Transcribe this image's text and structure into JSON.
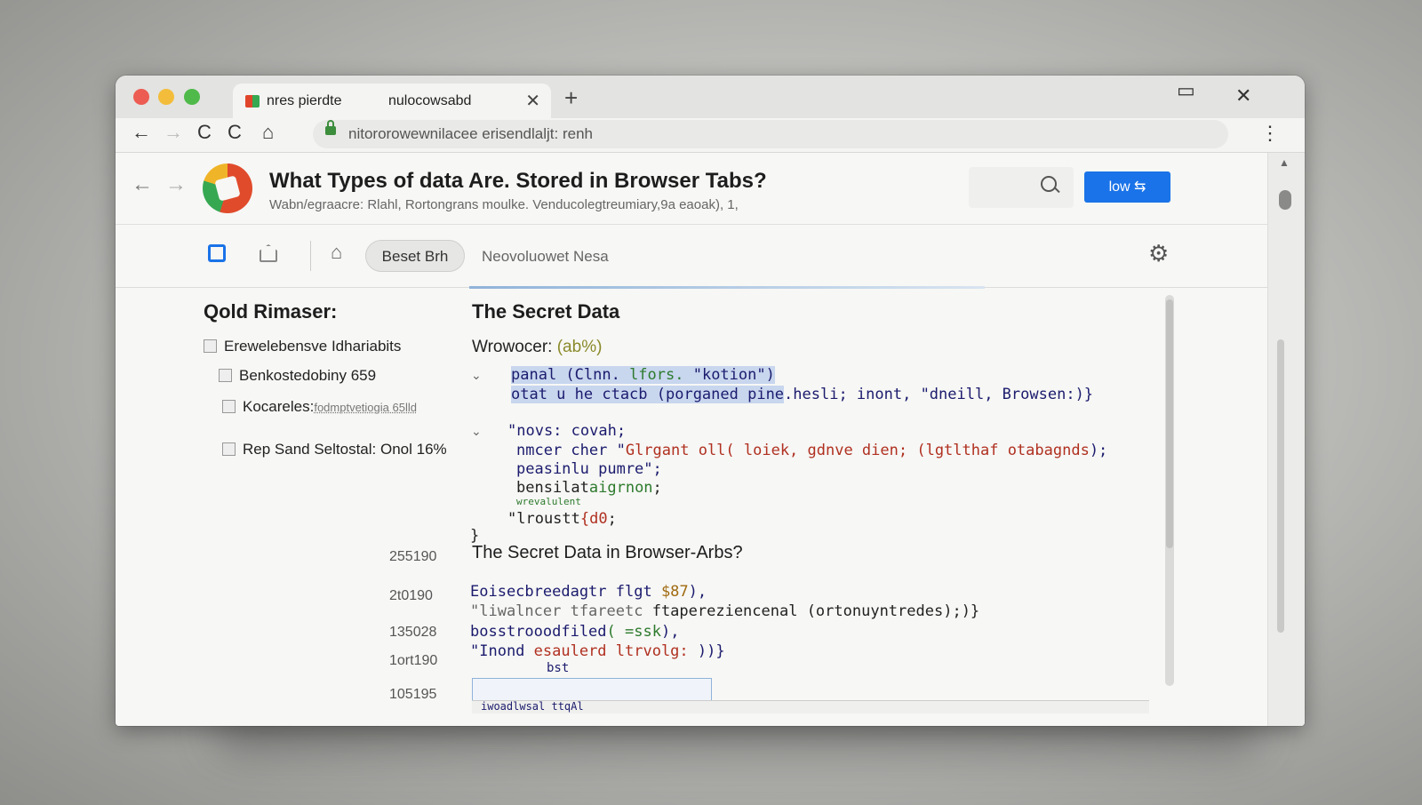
{
  "browser": {
    "tab": {
      "title": "nres pierdte",
      "title2": "nulocowsabd",
      "close": "✕"
    },
    "new_tab": "+",
    "window_controls": {
      "minimize": "▭",
      "close": "✕"
    },
    "nav": {
      "back": "←",
      "forward": "→",
      "reload": "C",
      "reload2": "C",
      "home": "⌂"
    },
    "url": "nitororowewnilacee erisendlaljt: renh",
    "menu": "⋮"
  },
  "site": {
    "back": "←",
    "forward": "→",
    "title": "What Types of data Are. Stored in Browser Tabs?",
    "subtitle": "Wabn/egraacre: Rlahl, Rortongrans moulke. Venducolegtreumiary,9a eaoak), 1,",
    "cta_label": "low ⇆",
    "pill_label": "Beset Brh",
    "subnav_link": "Neovoluowet Nesa",
    "gear": "⚙",
    "home": "⌂"
  },
  "left": {
    "title": "Qold Rimaser:",
    "items": [
      {
        "label": "Erewelebensve Idhariabits",
        "sub": ""
      },
      {
        "label": "Benkostedobiny 659",
        "sub": ""
      },
      {
        "label": "Kocareles:",
        "sub": "fodmptvetiogia 65lld"
      },
      {
        "label": "Rep Sand Seltostal: Onol 16%",
        "sub": ""
      }
    ],
    "numbers": [
      "255190",
      "2t0190",
      "135028",
      "1ort190",
      "105195"
    ]
  },
  "main": {
    "title": "The Secret Data",
    "subheading": "Wrowocer:",
    "subheading_meta": "(ab%)",
    "code1": {
      "line1a": "panal (Clnn. ",
      "line1b": "lfors.",
      "line1c": " \"kotion\")",
      "line2a": "otat u he ctacb (porganed pine",
      "line2b": ".hesli; inont, \"dneill, Browsen:)}"
    },
    "code2": {
      "line1": "\"novs: covah;",
      "line2a": "nmcer cher \"",
      "line2b": "Glrgant oll( loiek, gdnve dien; (lgtlthaf otabagnds",
      "line2c": ");",
      "line3": "peasinlu pumre\";",
      "line4a": "bensilat",
      "line4b": "aigrnon",
      "line4c": ";",
      "line5": "wrevalulent",
      "line6a": "\"lroustt",
      "line6b": "{d0",
      "line6c": ";",
      "line7": "}"
    },
    "title2": "The Secret Data  in Browser-Arbs?",
    "code3": {
      "line1a": "Eoisecbreedagtr flgt ",
      "line1b": "$87",
      "line1c": "),",
      "line2a": "\"liwalncer tfareetc ",
      "line2b": "ftapereziencenal (ortonuyntredes);)}",
      "line3a": "bosstrooodfiled",
      "line3b": "( =ssk",
      "line3c": "),",
      "line4a": "\"Inond ",
      "line4b": "esaulerd ltrvolg:",
      "line4c": " ))}",
      "line5": "bst"
    },
    "box_label": "iwoadlwsal ttqAl"
  }
}
